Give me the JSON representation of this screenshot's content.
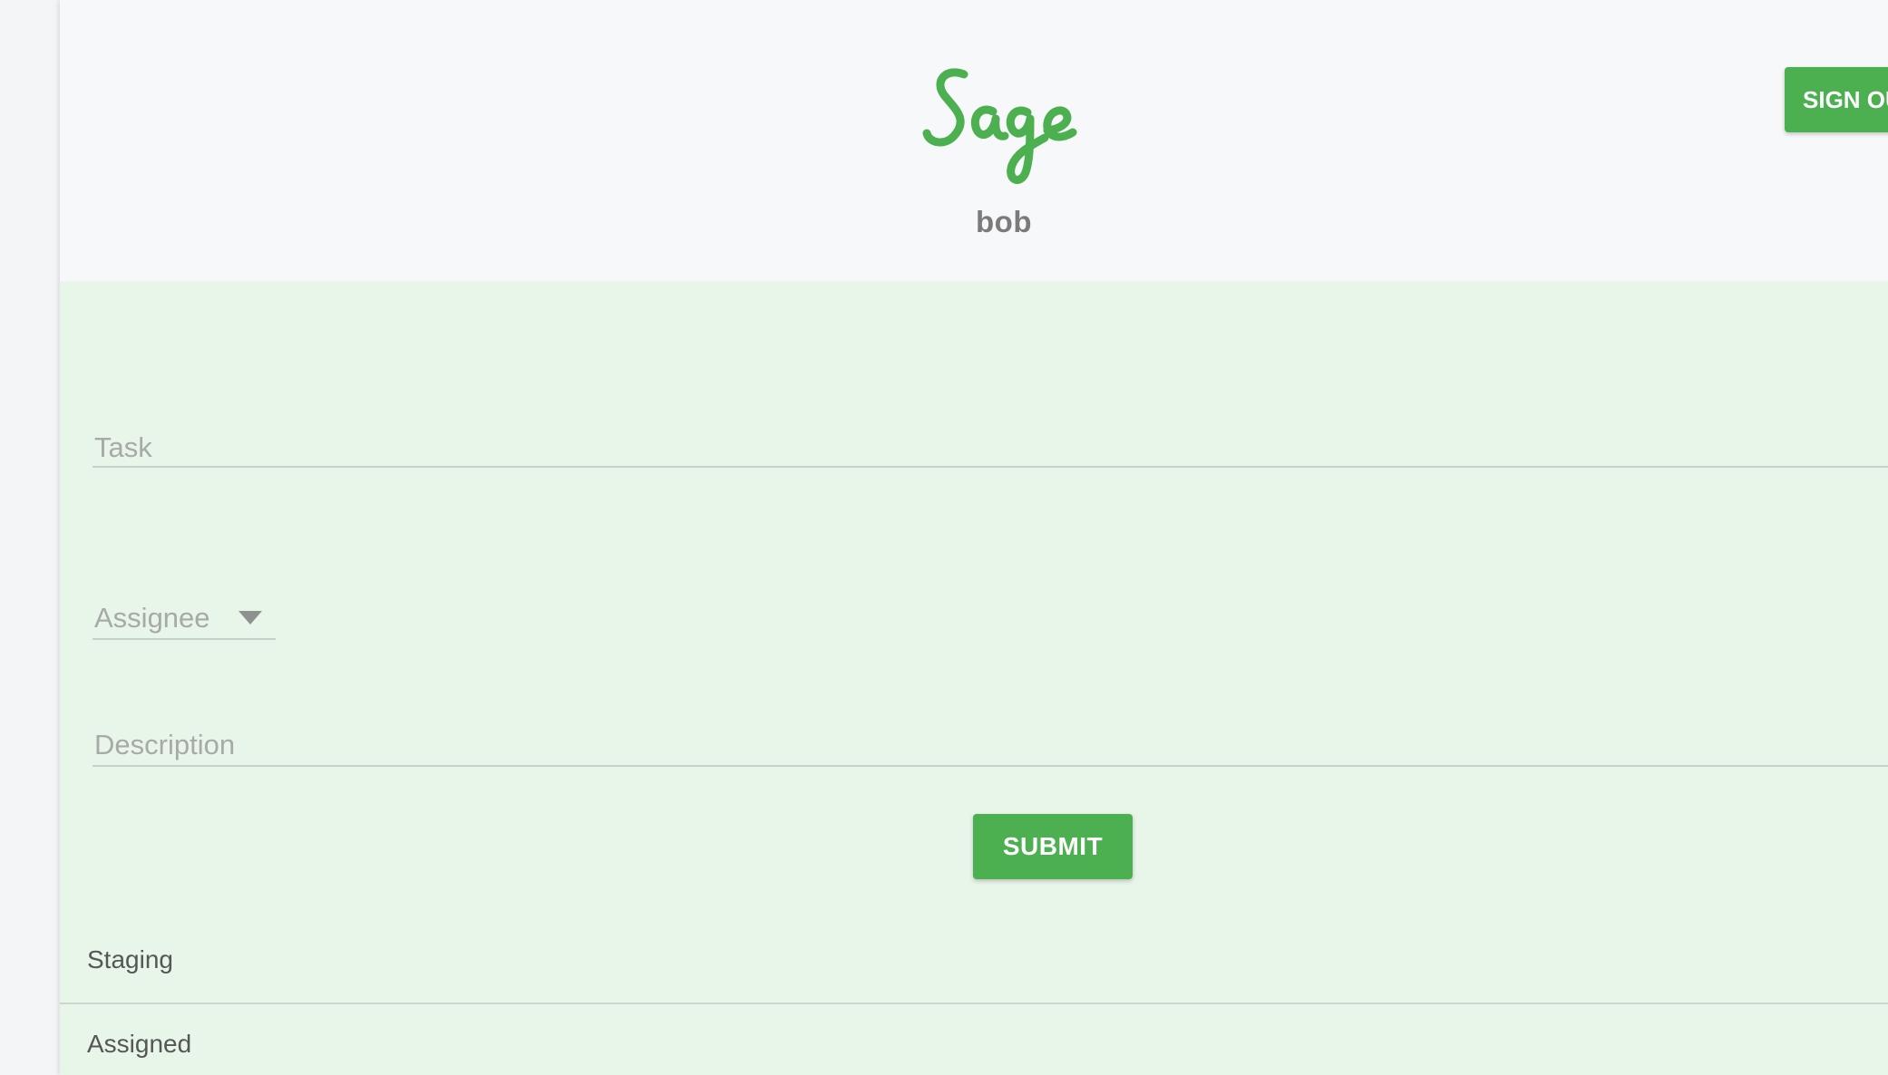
{
  "header": {
    "logo_text": "Sage",
    "username": "bob",
    "sign_out_label": "SIGN OUT"
  },
  "form": {
    "task_placeholder": "Task",
    "assignee_placeholder": "Assignee",
    "description_placeholder": "Description",
    "submit_label": "SUBMIT"
  },
  "sections": {
    "staging": "Staging",
    "assigned": "Assigned"
  },
  "colors": {
    "accent": "#4caf50",
    "form_background": "#e8f5e9",
    "header_background": "#f7f8fa"
  },
  "icons": {
    "assignee_dropdown": "caret-down-icon"
  }
}
